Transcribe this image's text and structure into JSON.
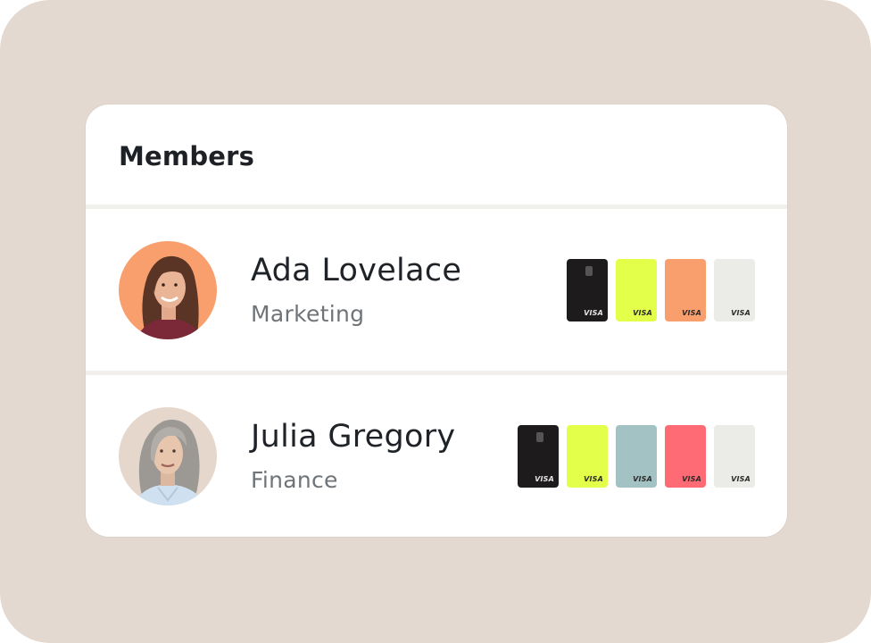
{
  "panel": {
    "title": "Members"
  },
  "members": [
    {
      "name": "Ada Lovelace",
      "department": "Marketing",
      "avatar_bg": "#f89f6d",
      "cards": [
        {
          "color": "#1d1b1b",
          "brand": "VISA",
          "chip": true
        },
        {
          "color": "#e4ff4a",
          "brand": "VISA",
          "chip": false
        },
        {
          "color": "#f89f6d",
          "brand": "VISA",
          "chip": false
        },
        {
          "color": "#ebebe7",
          "brand": "VISA",
          "chip": false
        }
      ]
    },
    {
      "name": "Julia Gregory",
      "department": "Finance",
      "avatar_bg": "#e5d7cc",
      "cards": [
        {
          "color": "#1d1b1b",
          "brand": "VISA",
          "chip": true
        },
        {
          "color": "#e4ff4a",
          "brand": "VISA",
          "chip": false
        },
        {
          "color": "#a3c2c3",
          "brand": "VISA",
          "chip": false
        },
        {
          "color": "#ff6b75",
          "brand": "VISA",
          "chip": false
        },
        {
          "color": "#ebebe7",
          "brand": "VISA",
          "chip": false
        }
      ]
    }
  ]
}
